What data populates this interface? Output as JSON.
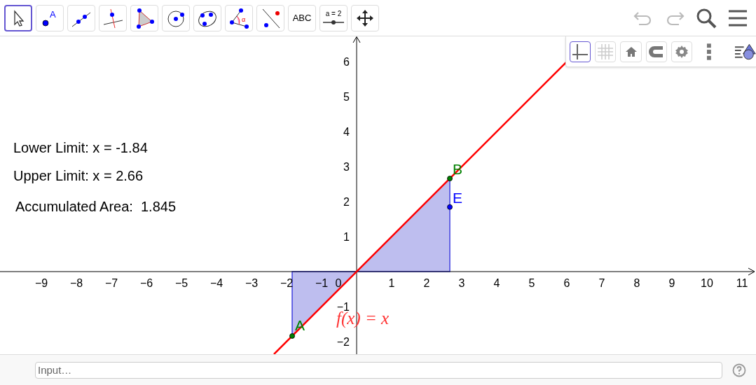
{
  "toolbar": {
    "tools": [
      {
        "kind": "move",
        "selected": true
      },
      {
        "kind": "point",
        "label": "A",
        "selected": false
      },
      {
        "kind": "line",
        "selected": false
      },
      {
        "kind": "perpendicular",
        "selected": false
      },
      {
        "kind": "polygon",
        "selected": false
      },
      {
        "kind": "circle",
        "selected": false
      },
      {
        "kind": "conic",
        "selected": false
      },
      {
        "kind": "angle",
        "label": "α",
        "selected": false
      },
      {
        "kind": "reflect",
        "selected": false
      },
      {
        "kind": "text",
        "label": "ABC",
        "selected": false
      },
      {
        "kind": "slider",
        "label": "a = 2",
        "selected": false
      },
      {
        "kind": "pan",
        "selected": false
      }
    ],
    "undo": {
      "disabled": true
    },
    "redo": {
      "disabled": true
    }
  },
  "style_bar": {
    "buttons": [
      {
        "kind": "axes",
        "selected": true
      },
      {
        "kind": "grid",
        "selected": false
      },
      {
        "kind": "home",
        "selected": false
      },
      {
        "kind": "snap",
        "selected": false
      },
      {
        "kind": "settings",
        "selected": false
      }
    ]
  },
  "graphics": {
    "x_ticks": [
      "−9",
      "−8",
      "−7",
      "−6",
      "−5",
      "−4",
      "−3",
      "−2",
      "−1",
      "0",
      "1",
      "2",
      "3",
      "4",
      "5",
      "6",
      "7",
      "8",
      "9",
      "10",
      "11"
    ],
    "y_ticks": [
      "6",
      "5",
      "4",
      "3",
      "2",
      "1",
      "−1",
      "−2"
    ],
    "texts": [
      "Lower Limit: x = -1.84",
      "Upper Limit: x = 2.66",
      "Accumulated Area:  1.845"
    ],
    "points": [
      {
        "label": "A",
        "color": "#008000"
      },
      {
        "label": "B",
        "color": "#008000"
      },
      {
        "label": "E",
        "color": "#0000ff"
      }
    ],
    "function_label": "f(x) = x"
  },
  "input_bar": {
    "placeholder": "Input…"
  }
}
